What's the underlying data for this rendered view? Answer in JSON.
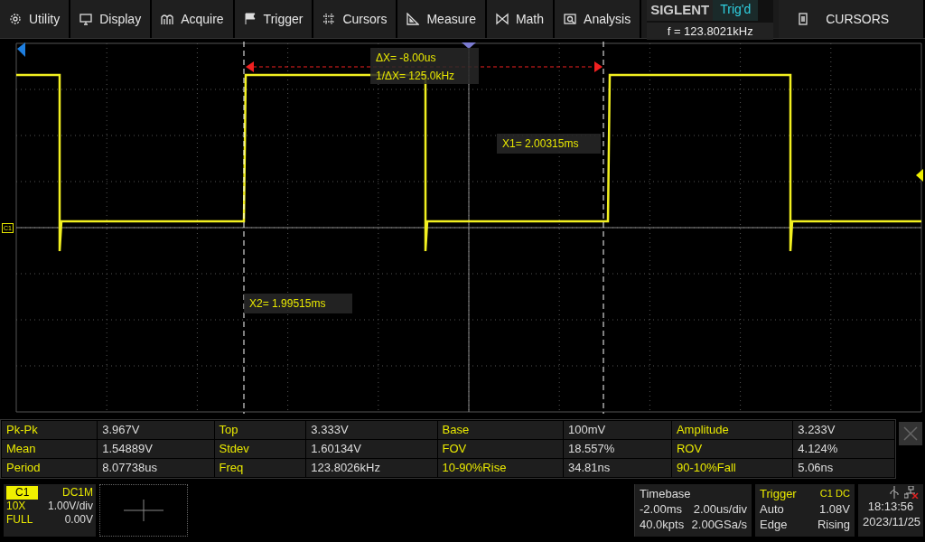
{
  "menu": [
    {
      "label": "Utility"
    },
    {
      "label": "Display"
    },
    {
      "label": "Acquire"
    },
    {
      "label": "Trigger"
    },
    {
      "label": "Cursors"
    },
    {
      "label": "Measure"
    },
    {
      "label": "Math"
    },
    {
      "label": "Analysis"
    }
  ],
  "status": {
    "brand": "SIGLENT",
    "trigger_state": "Trig'd",
    "frequency": "f = 123.8021kHz"
  },
  "side_panel": {
    "label": "CURSORS"
  },
  "plot": {
    "channel_marker": "C1",
    "delta_x": "ΔX= -8.00us",
    "inverse_delta_x": "1/ΔX= 125.0kHz",
    "x1": "X1= 2.00315ms",
    "x2": "X2= 1.99515ms"
  },
  "measurements": [
    [
      {
        "label": "Pk-Pk",
        "value": "3.967V"
      },
      {
        "label": "Top",
        "value": "3.333V"
      },
      {
        "label": "Base",
        "value": "100mV"
      },
      {
        "label": "Amplitude",
        "value": "3.233V"
      }
    ],
    [
      {
        "label": "Mean",
        "value": "1.54889V"
      },
      {
        "label": "Stdev",
        "value": "1.60134V"
      },
      {
        "label": "FOV",
        "value": "18.557%"
      },
      {
        "label": "ROV",
        "value": "4.124%"
      }
    ],
    [
      {
        "label": "Period",
        "value": "8.07738us"
      },
      {
        "label": "Freq",
        "value": "123.8026kHz"
      },
      {
        "label": "10-90%Rise",
        "value": "34.81ns"
      },
      {
        "label": "90-10%Fall",
        "value": "5.06ns"
      }
    ]
  ],
  "channel": {
    "name": "C1",
    "coupling": "DC1M",
    "probe": "10X",
    "scale": "1.00V/div",
    "bandwidth": "FULL",
    "offset": "0.00V"
  },
  "timebase": {
    "title": "Timebase",
    "delay": "-2.00ms",
    "scale": "2.00us/div",
    "memory": "40.0kpts",
    "sample_rate": "2.00GSa/s"
  },
  "trigger": {
    "title": "Trigger",
    "source": "C1",
    "coupling": "DC",
    "mode": "Auto",
    "level": "1.08V",
    "type": "Edge",
    "slope": "Rising"
  },
  "clock": {
    "time": "18:13:56",
    "date": "2023/11/25"
  }
}
